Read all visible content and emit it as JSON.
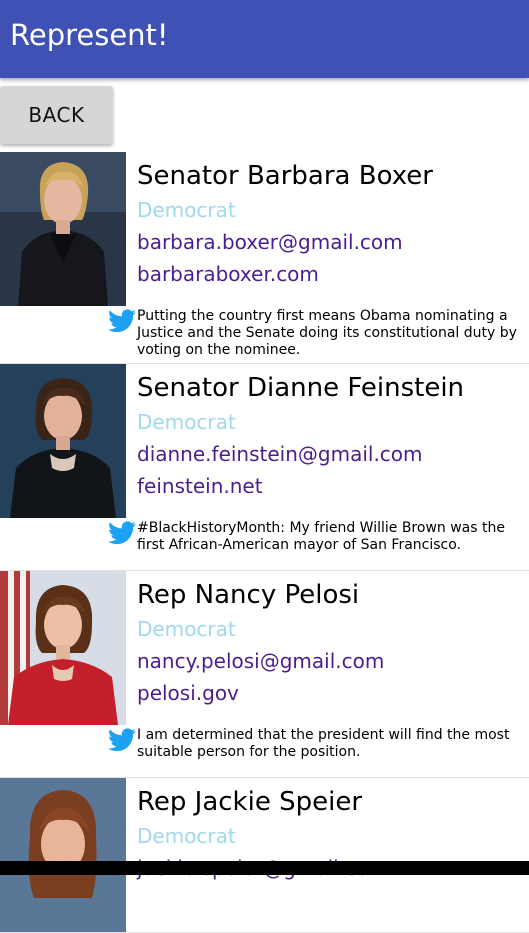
{
  "app": {
    "title": "Represent!"
  },
  "actions": {
    "back_label": "BACK"
  },
  "colors": {
    "appbar": "#3f51b5",
    "party": "#9fd8ef",
    "link": "#4b1e8f",
    "twitter": "#1da1f2"
  },
  "representatives": [
    {
      "name": "Senator Barbara Boxer",
      "party": "Democrat",
      "email": "barbara.boxer@gmail.com",
      "website": "barbaraboxer.com",
      "tweet": "Putting the country first means Obama nominating a Justice and the Senate doing its constitutional duty by voting on the nominee.",
      "tweet_icon": "twitter-bird-icon"
    },
    {
      "name": "Senator Dianne Feinstein",
      "party": "Democrat",
      "email": "dianne.feinstein@gmail.com",
      "website": "feinstein.net",
      "tweet": "#BlackHistoryMonth: My friend Willie Brown was the first African-American mayor of San Francisco.",
      "tweet_icon": "twitter-bird-icon"
    },
    {
      "name": "Rep Nancy Pelosi",
      "party": "Democrat",
      "email": "nancy.pelosi@gmail.com",
      "website": "pelosi.gov",
      "tweet": " I am determined that the president will find the most suitable person for the position.",
      "tweet_icon": "twitter-bird-icon"
    },
    {
      "name": "Rep Jackie Speier",
      "party": "Democrat",
      "email": "jackie.speier@gmail.com"
    }
  ]
}
